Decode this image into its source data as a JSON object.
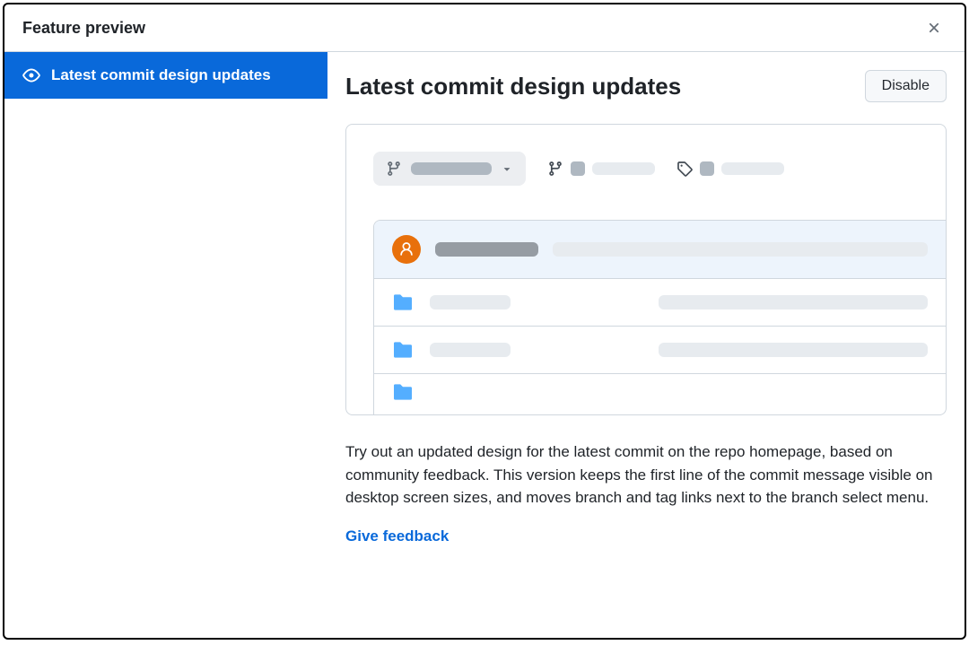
{
  "modal": {
    "title": "Feature preview",
    "close_label": "Close"
  },
  "sidebar": {
    "items": [
      {
        "label": "Latest commit design updates",
        "icon": "eye-icon",
        "selected": true
      }
    ]
  },
  "content": {
    "title": "Latest commit design updates",
    "disable_label": "Disable",
    "description": "Try out an updated design for the latest commit on the repo homepage, based on community feedback. This version keeps the first line of the commit message visible on desktop screen sizes, and moves branch and tag links next to the branch select menu.",
    "feedback_label": "Give feedback"
  },
  "colors": {
    "accent": "#0969da",
    "avatar": "#e8700b",
    "folder": "#54aeff"
  }
}
